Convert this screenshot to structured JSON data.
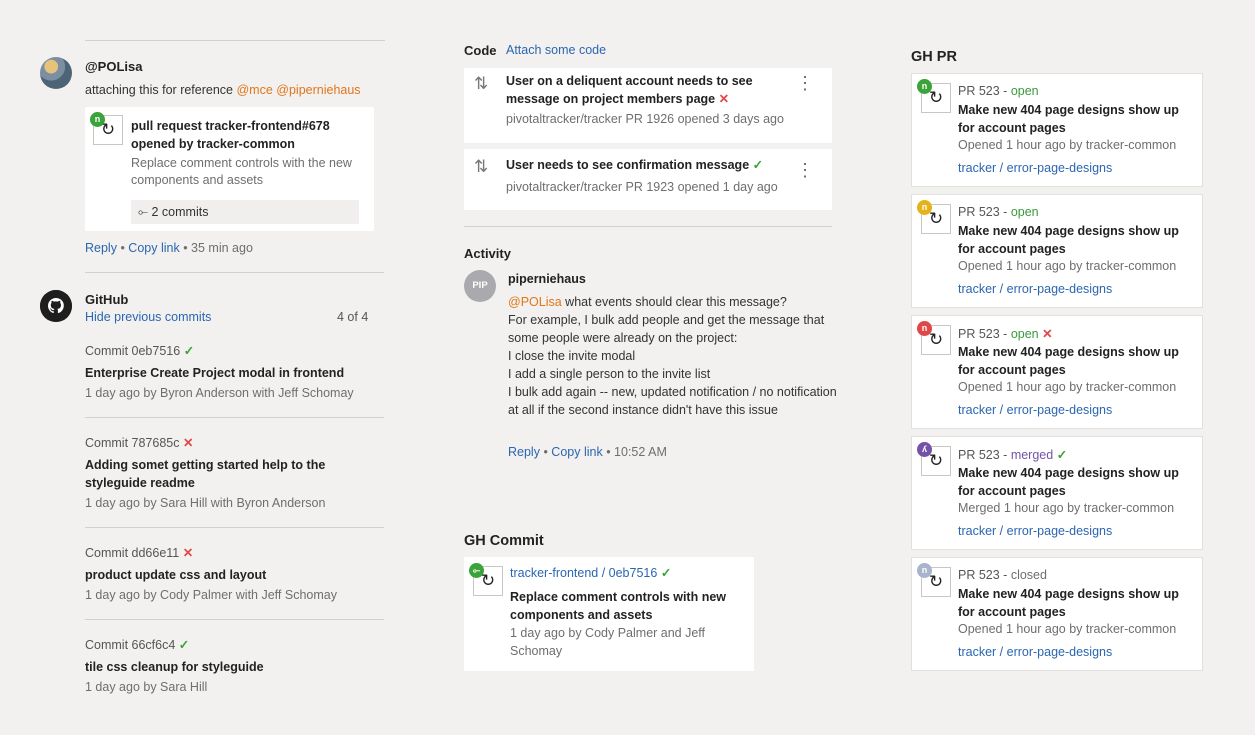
{
  "colors": {
    "link": "#2b66b0",
    "mention": "#e2761a",
    "success": "#3aa33a",
    "fail": "#e04848",
    "merged": "#7452a8"
  },
  "comment": {
    "author": "@POLisa",
    "text_prefix": "attaching this for reference",
    "mentions": [
      "@mce",
      "@piperniehaus"
    ],
    "pr_card": {
      "title": "pull request tracker-frontend#678 opened by tracker-common",
      "description": "Replace comment controls with the new components and assets",
      "commits": "2 commits",
      "status_color": "#3aa33a"
    },
    "reply": "Reply",
    "copy_link": "Copy link",
    "time": "35 min ago"
  },
  "github": {
    "title": "GitHub",
    "hide_label": "Hide previous commits",
    "count": "4 of 4",
    "commits": [
      {
        "header": "Commit 0eb7516",
        "status": "success",
        "message": "Enterprise Create Project modal in frontend",
        "meta": "1 day ago by Byron Anderson with Jeff Schomay"
      },
      {
        "header": "Commit 787685c",
        "status": "fail",
        "message": "Adding somet getting started help to the styleguide readme",
        "meta": "1 day ago by Sara Hill with Byron Anderson"
      },
      {
        "header": "Commit dd66e11",
        "status": "fail",
        "message": "product update css and layout",
        "meta": "1 day ago by Cody Palmer with Jeff Schomay"
      },
      {
        "header": "Commit 66cf6c4",
        "status": "success",
        "message": "tile css cleanup for styleguide",
        "meta": "1 day ago by Sara Hill"
      }
    ]
  },
  "code": {
    "title": "Code",
    "attach": "Attach some code",
    "items": [
      {
        "title": "User on a deliquent account needs to see message on project members page",
        "status": "fail",
        "meta": "pivotaltracker/tracker PR 1926 opened 3 days ago"
      },
      {
        "title": "User needs to see confirmation message",
        "status": "success",
        "meta": "pivotaltracker/tracker PR 1923 opened 1 day ago"
      }
    ]
  },
  "activity": {
    "title": "Activity",
    "avatar_initials": "PIP",
    "user": "piperniehaus",
    "mention": "@POLisa",
    "first_line": " what events should clear this message?",
    "lines": [
      "For example, I bulk add people and get the message that some people were already on the project:",
      "I close the invite modal",
      "I add a single person to the invite list",
      "I bulk add again -- new, updated notification / no notification at all if the second instance didn't have this issue"
    ],
    "reply": "Reply",
    "copy_link": "Copy link",
    "time": "10:52 AM"
  },
  "gh_commit": {
    "title": "GH Commit",
    "link": "tracker-frontend / 0eb7516",
    "message": "Replace comment controls with new components and assets",
    "meta": "1 day ago by Cody Palmer and Jeff Schomay"
  },
  "gh_pr": {
    "title": "GH PR",
    "items": [
      {
        "pr": "PR 523 - ",
        "state": "open",
        "state_class": "st-open",
        "mark": "",
        "dot_color": "#3aa33a",
        "dot_icon": "n",
        "title": "Make new 404 page designs show  up for account pages",
        "meta": "Opened 1 hour ago by tracker-common",
        "link": "tracker / error-page-designs"
      },
      {
        "pr": "PR 523 - ",
        "state": "open",
        "state_class": "st-open",
        "mark": "",
        "dot_color": "#e6b21a",
        "dot_icon": "n",
        "title": "Make new 404 page designs show  up for account pages",
        "meta": "Opened 1 hour ago by tracker-common",
        "link": "tracker / error-page-designs"
      },
      {
        "pr": "PR 523 - ",
        "state": "open",
        "state_class": "st-open",
        "mark": "✕",
        "dot_color": "#e04848",
        "dot_icon": "n",
        "title": "Make new 404 page designs show  up for account pages",
        "meta": "Opened 1 hour ago by tracker-common",
        "link": "tracker / error-page-designs"
      },
      {
        "pr": "PR 523 - ",
        "state": "merged",
        "state_class": "st-merged",
        "mark": "✓",
        "dot_color": "#7452a8",
        "dot_icon": "ʎ",
        "title": "Make new 404 page designs show  up for account pages",
        "meta": "Merged 1 hour ago by tracker-common",
        "link": "tracker / error-page-designs"
      },
      {
        "pr": "PR 523 - ",
        "state": "closed",
        "state_class": "st-closed",
        "mark": "",
        "dot_color": "#a8b4cc",
        "dot_icon": "n",
        "title": "Make new 404 page designs show  up for account pages",
        "meta": "Opened 1 hour ago by tracker-common",
        "link": "tracker / error-page-designs"
      }
    ]
  }
}
